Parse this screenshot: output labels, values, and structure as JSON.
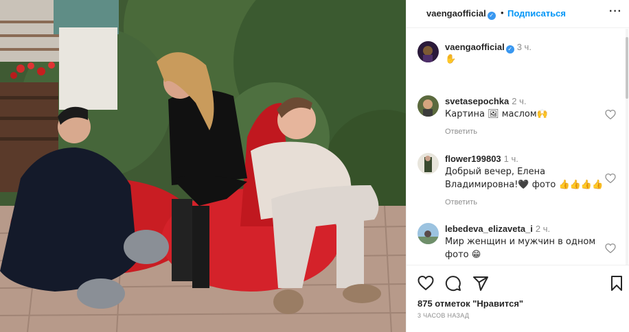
{
  "header": {
    "username": "vaengaofficial",
    "verified_mark": "✓",
    "separator": "•",
    "follow_label": "Подписаться",
    "more_label": "···"
  },
  "caption": {
    "username": "vaengaofficial",
    "time": "3 ч.",
    "text": "✋"
  },
  "comments": [
    {
      "username": "svetasepochka",
      "time": "2 ч.",
      "text": "Картина 🖼 маслом🙌",
      "reply_label": "Ответить"
    },
    {
      "username": "flower199803",
      "time": "1 ч.",
      "text_line1": "Добрый вечер, Елена",
      "text_line2": "Владимировна!🖤 фото 👍👍👍👍",
      "reply_label": "Ответить"
    },
    {
      "username": "lebedeva_elizaveta_i",
      "time": "2 ч.",
      "text_line1": "Мир женщин и мужчин в одном",
      "text_line2": "фото 😁"
    }
  ],
  "actions": {
    "icons": [
      "heart-icon",
      "comment-icon",
      "share-icon",
      "bookmark-icon"
    ],
    "likes_text": "875 отметок \"Нравится\"",
    "time_ago": "3 ЧАСОВ НАЗАД"
  },
  "colors": {
    "accent": "#0095f6",
    "verified": "#3897f0",
    "muted": "#8e8e8e",
    "text": "#262626"
  }
}
